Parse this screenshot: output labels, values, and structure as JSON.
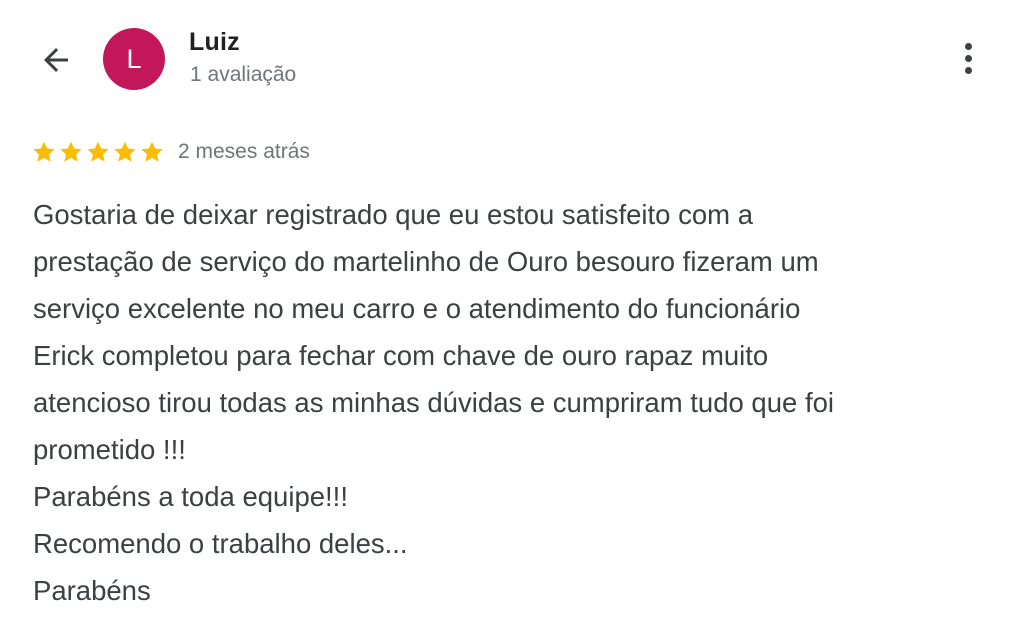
{
  "header": {
    "back_icon": "arrow-left-icon",
    "more_icon": "more-vert-icon"
  },
  "user": {
    "initial": "L",
    "name": "Luiz",
    "review_count": "1 avaliação",
    "avatar_color": "#c2185b"
  },
  "review": {
    "rating": 5,
    "max_rating": 5,
    "star_color": "#fbbc04",
    "date": "2 meses atrás",
    "text_lines": [
      "Gostaria de deixar registrado que eu estou satisfeito com a",
      "prestação de serviço do martelinho de Ouro besouro fizeram um",
      "serviço excelente no meu carro e o atendimento do funcionário",
      "Erick completou para fechar com chave de ouro rapaz muito",
      "atencioso tirou todas as minhas dúvidas e cumpriram tudo que foi",
      "prometido !!!",
      "Parabéns a toda equipe!!!",
      "Recomendo o trabalho deles...",
      "Parabéns"
    ]
  }
}
